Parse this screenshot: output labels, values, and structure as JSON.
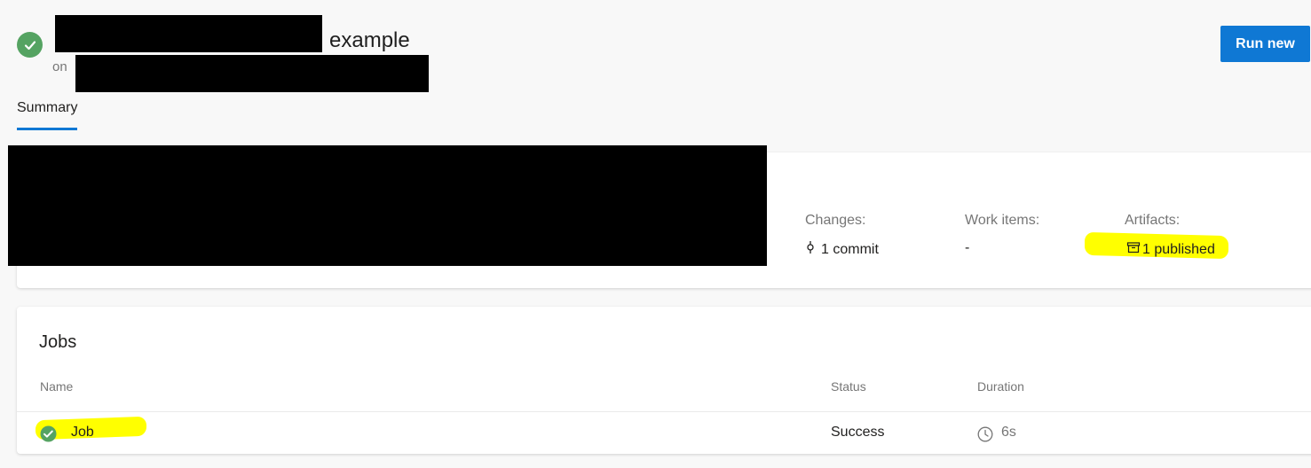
{
  "header": {
    "title_suffix": "example",
    "on_label": "on",
    "run_new_label": "Run new"
  },
  "tabs": [
    {
      "label": "Summary",
      "active": true
    }
  ],
  "summary": {
    "changes": {
      "label": "Changes:",
      "value": "1 commit",
      "icon": "commit-icon"
    },
    "work_items": {
      "label": "Work items:",
      "value": "-"
    },
    "artifacts": {
      "label": "Artifacts:",
      "value": "1 published",
      "icon": "artifact-package-icon"
    }
  },
  "jobs": {
    "title": "Jobs",
    "columns": {
      "name": "Name",
      "status": "Status",
      "duration": "Duration"
    },
    "rows": [
      {
        "name": "Job",
        "status": "Success",
        "duration": "6s",
        "status_icon": "success-check-icon",
        "duration_icon": "clock-icon"
      }
    ]
  },
  "colors": {
    "accent": "#0f78d4",
    "success": "#55a362",
    "highlight": "#ffff00"
  }
}
